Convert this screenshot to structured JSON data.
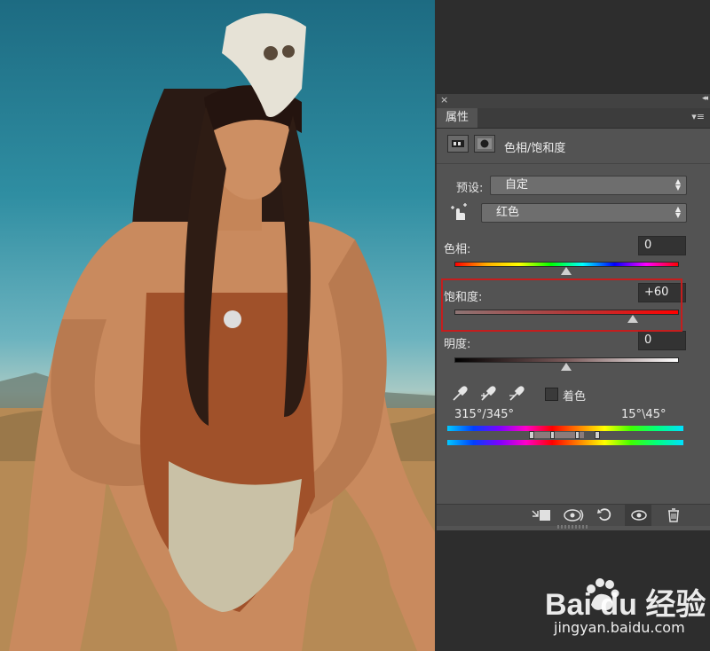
{
  "panel": {
    "close": "×",
    "collapse": "◂◂",
    "tab_label": "属性",
    "menu": "▾≡",
    "title": "色相/饱和度"
  },
  "controls": {
    "preset_label": "预设:",
    "preset_value": "自定",
    "channel_value": "红色",
    "hue_label": "色相:",
    "hue_value": "0",
    "saturation_label": "饱和度:",
    "saturation_value": "+60",
    "lightness_label": "明度:",
    "lightness_value": "0",
    "colorize_label": "着色",
    "range_left": "315°/345°",
    "range_right": "15°\\45°",
    "slider_levels": {
      "hue": 0.5,
      "saturation": 0.8,
      "lightness": 0.5
    }
  },
  "icons": {
    "target_adjust": "hand-pointer-icon",
    "eyedropper": "eyedropper-icon",
    "eyedropper_add": "eyedropper-plus-icon",
    "eyedropper_subtract": "eyedropper-minus-icon",
    "clip": "clip-to-layer-icon",
    "view_previous": "view-previous-icon",
    "reset": "reset-icon",
    "visibility": "eye-icon",
    "delete": "trash-icon"
  },
  "watermark": {
    "main": "Bai du 经验",
    "sub": "jingyan.baidu.com"
  },
  "colors": {
    "highlight": "#c41e1e",
    "panel_bg": "#535353"
  }
}
